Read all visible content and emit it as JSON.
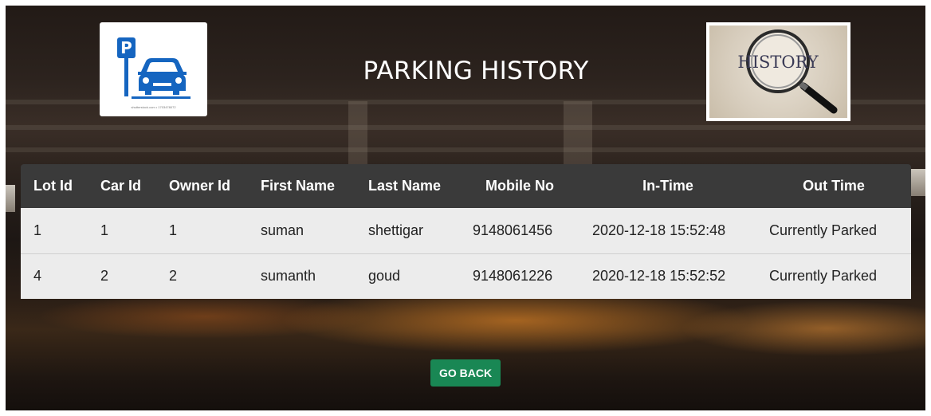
{
  "header": {
    "title": "PARKING HISTORY",
    "left_logo_icon": "parking-car-icon",
    "left_logo_caption": "shutterstock.com • 1703478072",
    "right_logo_icon": "magnifier-history-icon",
    "right_logo_text": "HISTORY"
  },
  "table": {
    "columns": [
      "Lot Id",
      "Car Id",
      "Owner Id",
      "First Name",
      "Last Name",
      "Mobile No",
      "In-Time",
      "Out Time"
    ],
    "rows": [
      [
        "1",
        "1",
        "1",
        "suman",
        "shettigar",
        "9148061456",
        "2020-12-18 15:52:48",
        "Currently Parked"
      ],
      [
        "4",
        "2",
        "2",
        "sumanth",
        "goud",
        "9148061226",
        "2020-12-18 15:52:52",
        "Currently Parked"
      ]
    ]
  },
  "actions": {
    "go_back_label": "GO BACK"
  },
  "colors": {
    "header_row_bg": "#3a3a3a",
    "body_row_bg": "#ececec",
    "button_bg": "#198754",
    "parking_sign_blue": "#1565c0"
  }
}
